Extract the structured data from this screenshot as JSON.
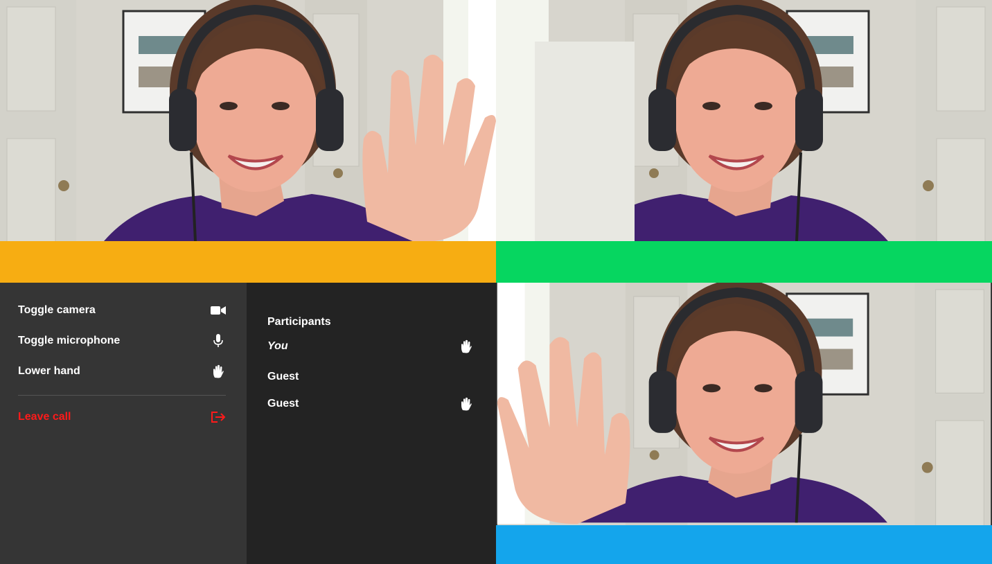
{
  "colors": {
    "tile_1_bar": "#f7ad12",
    "tile_2_bar": "#06d660",
    "tile_3_bar": "#14a5ec",
    "leave": "#ff1a1a"
  },
  "controls": {
    "items": [
      {
        "label": "Toggle camera",
        "icon": "video-camera-icon"
      },
      {
        "label": "Toggle microphone",
        "icon": "microphone-icon"
      },
      {
        "label": "Lower hand",
        "icon": "raised-hand-icon"
      }
    ],
    "leave": {
      "label": "Leave call",
      "icon": "leave-icon"
    }
  },
  "participants": {
    "title": "Participants",
    "list": [
      {
        "name": "You",
        "hand_raised": true
      },
      {
        "name": "Guest",
        "hand_raised": false
      },
      {
        "name": "Guest",
        "hand_raised": true
      }
    ]
  }
}
